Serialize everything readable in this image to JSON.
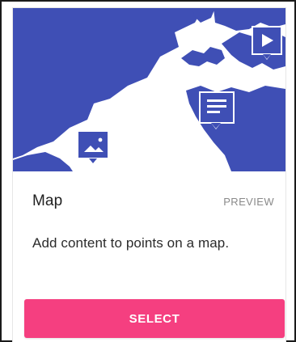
{
  "card": {
    "title": "Map",
    "badge": "PREVIEW",
    "description": "Add content to points on a map.",
    "select_label": "SELECT"
  },
  "icons": {
    "hero": "world-map-illustration",
    "marker_image": "image-marker-icon",
    "marker_video": "video-marker-icon",
    "marker_text": "text-marker-icon"
  },
  "colors": {
    "map_blue": "#3f4fb5",
    "button_pink": "#f53f80",
    "button_text": "#ffffff",
    "title_text": "#212121",
    "badge_text": "#8a8a8a"
  }
}
